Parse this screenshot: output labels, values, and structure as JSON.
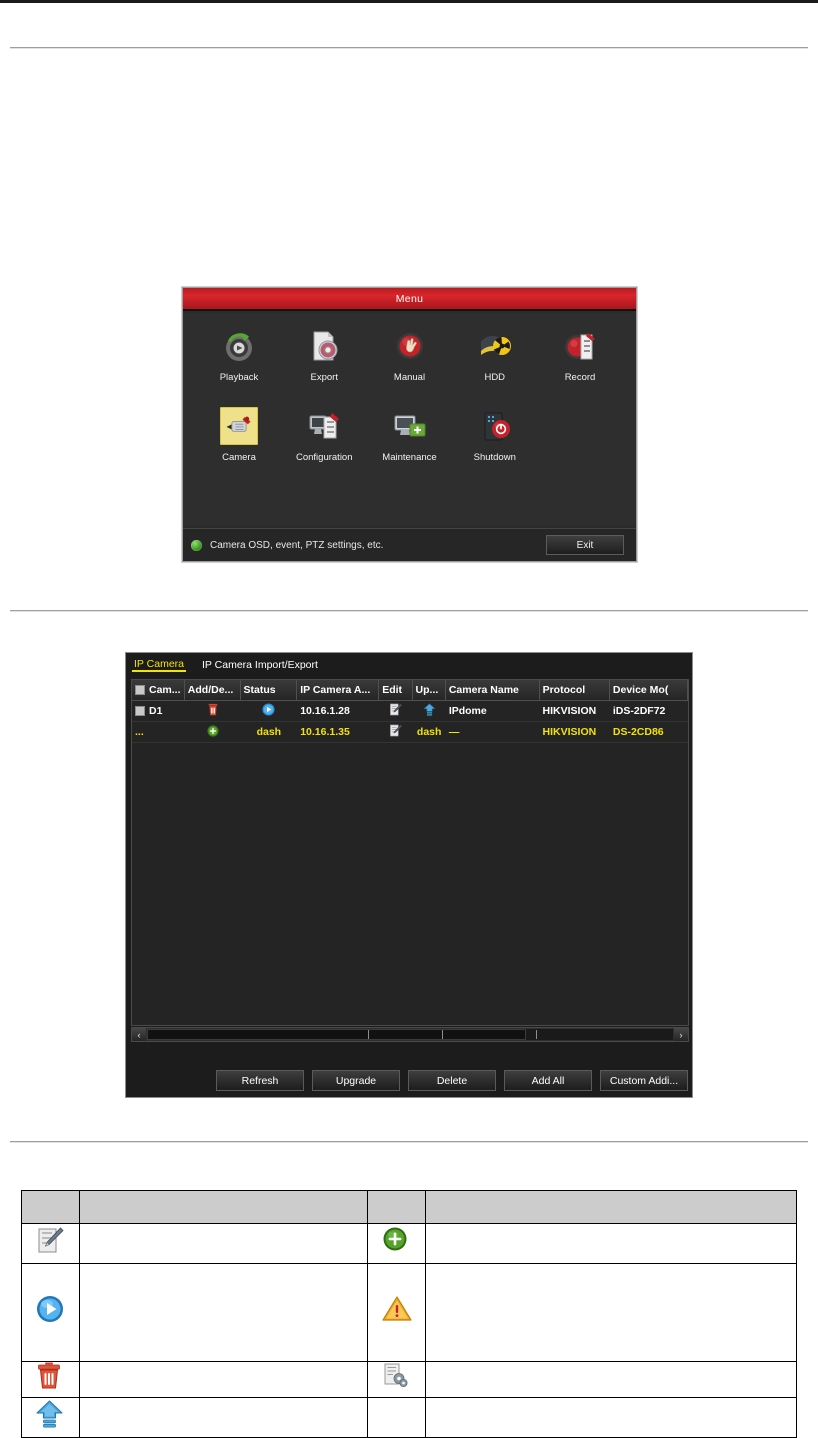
{
  "menu_dialog": {
    "title": "Menu",
    "items_row1": [
      {
        "label": "Playback",
        "icon": "playback-icon"
      },
      {
        "label": "Export",
        "icon": "export-icon"
      },
      {
        "label": "Manual",
        "icon": "manual-icon"
      },
      {
        "label": "HDD",
        "icon": "hdd-icon"
      },
      {
        "label": "Record",
        "icon": "record-icon"
      }
    ],
    "items_row2": [
      {
        "label": "Camera",
        "icon": "camera-icon",
        "selected": true
      },
      {
        "label": "Configuration",
        "icon": "configuration-icon",
        "selected": false
      },
      {
        "label": "Maintenance",
        "icon": "maintenance-icon",
        "selected": false
      },
      {
        "label": "Shutdown",
        "icon": "shutdown-icon",
        "selected": false
      }
    ],
    "status_text": "Camera OSD, event, PTZ settings, etc.",
    "status_icon": "green-info-dot",
    "exit_label": "Exit",
    "accent_color": "#d8262c",
    "selected_highlight_color": "#efe08a"
  },
  "ip_camera_panel": {
    "tabs": [
      {
        "label": "IP Camera",
        "active": true
      },
      {
        "label": "IP Camera Import/Export",
        "active": false
      }
    ],
    "active_tab_color": "#f2e207",
    "columns": [
      "Cam...",
      "Add/De...",
      "Status",
      "IP Camera A...",
      "Edit",
      "Up...",
      "Camera Name",
      "Protocol",
      "Device Mo("
    ],
    "rows": [
      {
        "highlight": false,
        "checkbox_label": "D1",
        "add_delete_icon": "trash-icon",
        "status_icon": "play-icon",
        "ip_address": "10.16.1.28",
        "edit_icon": "edit-icon",
        "upgrade_icon": "upgrade-icon",
        "camera_name": "IPdome",
        "protocol": "HIKVISION",
        "device_model": "iDS-2DF72"
      },
      {
        "highlight": true,
        "checkbox_label": "...",
        "add_delete_icon": "add-icon",
        "status_icon": "dash",
        "ip_address": "10.16.1.35",
        "edit_icon": "edit-icon",
        "upgrade_icon": "dash",
        "camera_name": "—",
        "protocol": "HIKVISION",
        "device_model": "DS-2CD86"
      }
    ],
    "scrollbar": {
      "left_arrow": "‹",
      "right_arrow": "›"
    },
    "buttons": [
      "Refresh",
      "Upgrade",
      "Delete",
      "Add All",
      "Custom Addi..."
    ]
  },
  "legend_table": {
    "header": [
      "",
      "",
      "",
      ""
    ],
    "rows": [
      {
        "icon_left": "edit-icon",
        "text_left": "",
        "icon_right": "add-icon",
        "text_right": ""
      },
      {
        "icon_left": "play-icon",
        "text_left": "",
        "icon_right": "warning-icon",
        "text_right": ""
      },
      {
        "icon_left": "trash-icon",
        "text_left": "",
        "icon_right": "advanced-settings-icon",
        "text_right": ""
      },
      {
        "icon_left": "upgrade-icon",
        "text_left": "",
        "icon_right": "",
        "text_right": ""
      }
    ]
  }
}
